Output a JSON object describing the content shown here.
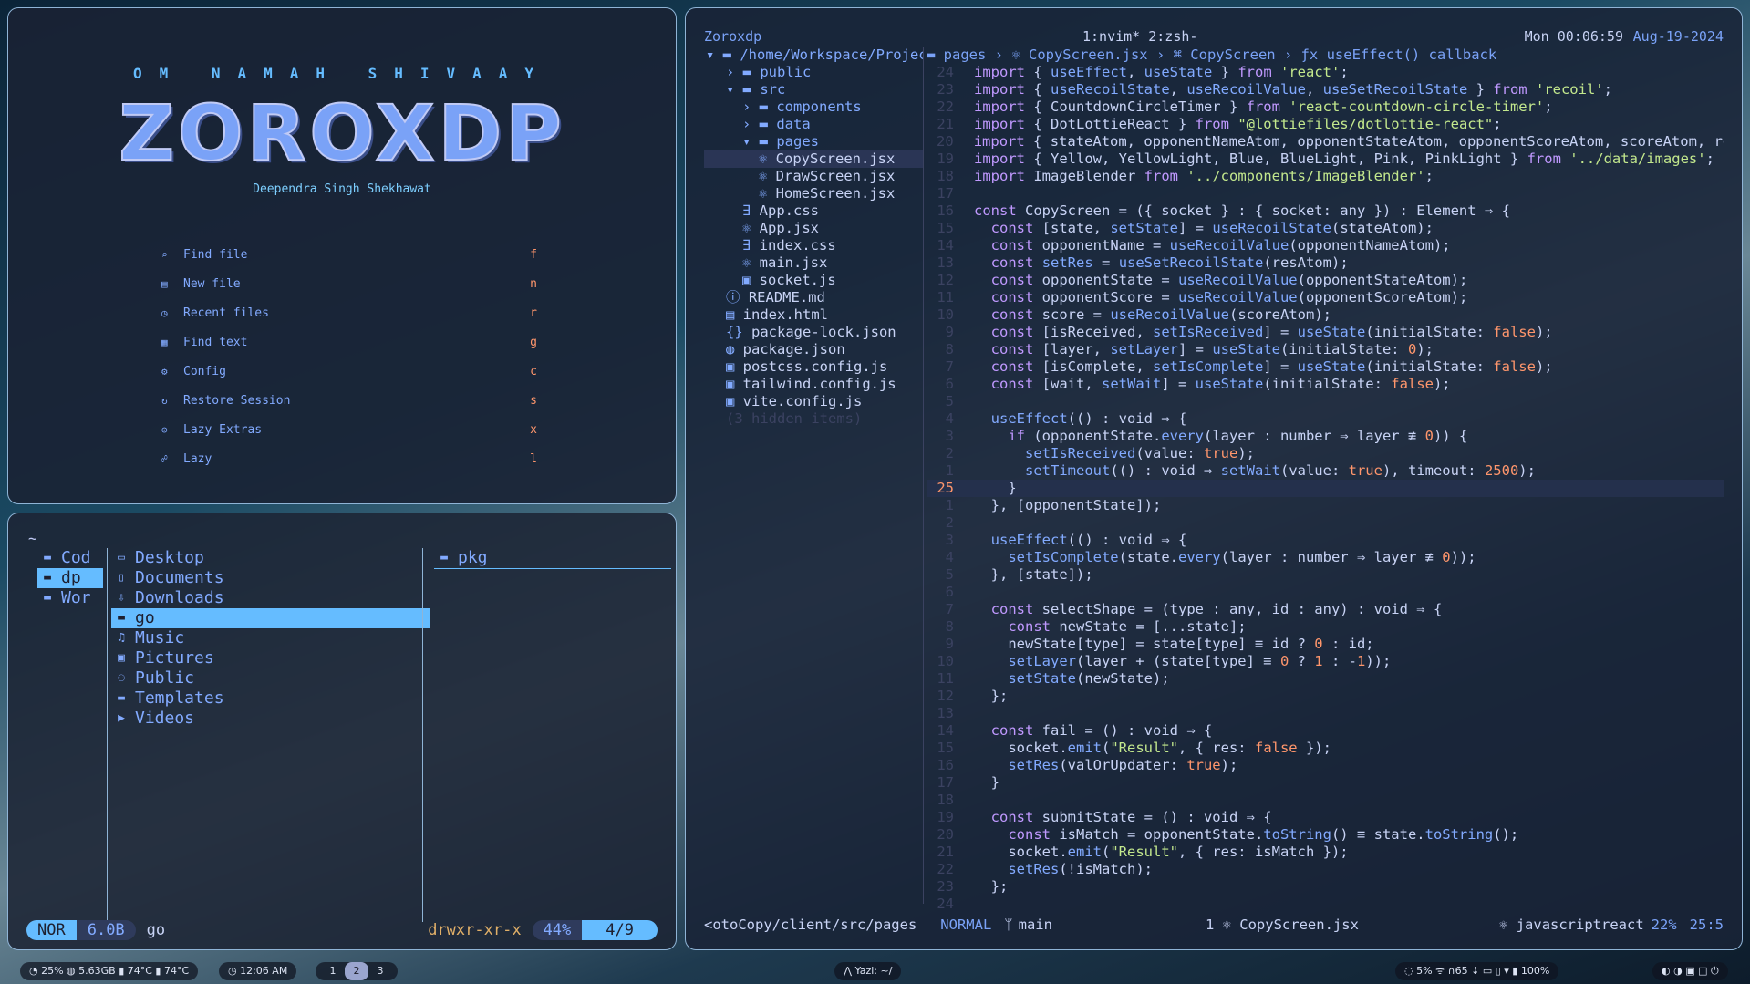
{
  "dashboard": {
    "om": "OM NAMAH SHIVAAY",
    "logo": "ZOROXDP",
    "author": "Deependra Singh Shekhawat",
    "items": [
      {
        "icon": "⌕",
        "label": "Find file",
        "key": "f"
      },
      {
        "icon": "▤",
        "label": "New file",
        "key": "n"
      },
      {
        "icon": "◷",
        "label": "Recent files",
        "key": "r"
      },
      {
        "icon": "▦",
        "label": "Find text",
        "key": "g"
      },
      {
        "icon": "⚙",
        "label": "Config",
        "key": "c"
      },
      {
        "icon": "↻",
        "label": "Restore Session",
        "key": "s"
      },
      {
        "icon": "⊙",
        "label": "Lazy Extras",
        "key": "x"
      },
      {
        "icon": "☍",
        "label": "Lazy",
        "key": "l"
      }
    ]
  },
  "yazi": {
    "cwd": "~",
    "parent": [
      "Cod",
      "dp",
      "Wor"
    ],
    "current": [
      {
        "icon": "▭",
        "name": "Desktop"
      },
      {
        "icon": "▯",
        "name": "Documents"
      },
      {
        "icon": "⇩",
        "name": "Downloads"
      },
      {
        "icon": "▬",
        "name": "go"
      },
      {
        "icon": "♫",
        "name": "Music"
      },
      {
        "icon": "▣",
        "name": "Pictures"
      },
      {
        "icon": "⚇",
        "name": "Public"
      },
      {
        "icon": "▬",
        "name": "Templates"
      },
      {
        "icon": "▶",
        "name": "Videos"
      }
    ],
    "preview": [
      "pkg"
    ],
    "status": {
      "mode": "NOR",
      "size": "6.0B",
      "name": "go",
      "perm": "drwxr-xr-x",
      "percent": "44%",
      "pos": "4/9"
    }
  },
  "nvim": {
    "session": "Zoroxdp",
    "windows": "1:nvim* 2:zsh-",
    "datetime": "Mon 00:06:59",
    "date": "Aug-19-2024",
    "tree": [
      {
        "d": 0,
        "icon": "▾ ▬",
        "name": "/home/Workspace/Project"
      },
      {
        "d": 1,
        "icon": "› ▬",
        "name": "public"
      },
      {
        "d": 1,
        "icon": "▾ ▬",
        "name": "src"
      },
      {
        "d": 2,
        "icon": "› ▬",
        "name": "components"
      },
      {
        "d": 2,
        "icon": "› ▬",
        "name": "data"
      },
      {
        "d": 2,
        "icon": "▾ ▬",
        "name": "pages"
      },
      {
        "d": 3,
        "icon": "⚛",
        "name": "CopyScreen.jsx"
      },
      {
        "d": 3,
        "icon": "⚛",
        "name": "DrawScreen.jsx"
      },
      {
        "d": 3,
        "icon": "⚛",
        "name": "HomeScreen.jsx"
      },
      {
        "d": 2,
        "icon": "∃",
        "name": "App.css"
      },
      {
        "d": 2,
        "icon": "⚛",
        "name": "App.jsx"
      },
      {
        "d": 2,
        "icon": "∃",
        "name": "index.css"
      },
      {
        "d": 2,
        "icon": "⚛",
        "name": "main.jsx"
      },
      {
        "d": 2,
        "icon": "▣",
        "name": "socket.js"
      },
      {
        "d": 1,
        "icon": "ⓘ",
        "name": "README.md"
      },
      {
        "d": 1,
        "icon": "▤",
        "name": "index.html"
      },
      {
        "d": 1,
        "icon": "{}",
        "name": "package-lock.json"
      },
      {
        "d": 1,
        "icon": "◍",
        "name": "package.json"
      },
      {
        "d": 1,
        "icon": "▣",
        "name": "postcss.config.js"
      },
      {
        "d": 1,
        "icon": "▣",
        "name": "tailwind.config.js"
      },
      {
        "d": 1,
        "icon": "▣",
        "name": "vite.config.js"
      },
      {
        "d": 1,
        "icon": "",
        "name": "(3 hidden items)"
      }
    ],
    "breadcrumb": "▬ pages › ⚛ CopyScreen.jsx › ⌘ CopyScreen › ƒx useEffect() callback",
    "lines": [
      {
        "n": "24",
        "t": "import { useEffect, useState } from 'react';"
      },
      {
        "n": "23",
        "t": "import { useRecoilState, useRecoilValue, useSetRecoilState } from 'recoil';"
      },
      {
        "n": "22",
        "t": "import { CountdownCircleTimer } from 'react-countdown-circle-timer';"
      },
      {
        "n": "21",
        "t": "import { DotLottieReact } from \"@lottiefiles/dotlottie-react\";"
      },
      {
        "n": "20",
        "t": "import { stateAtom, opponentNameAtom, opponentStateAtom, opponentScoreAtom, scoreAtom, re"
      },
      {
        "n": "19",
        "t": "import { Yellow, YellowLight, Blue, BlueLight, Pink, PinkLight } from '../data/images';"
      },
      {
        "n": "18",
        "t": "import ImageBlender from '../components/ImageBlender';"
      },
      {
        "n": "17",
        "t": ""
      },
      {
        "n": "16",
        "t": "const CopyScreen = ({ socket } : { socket: any }) : Element ⇒ {"
      },
      {
        "n": "15",
        "t": "  const [state, setState] = useRecoilState(stateAtom);"
      },
      {
        "n": "14",
        "t": "  const opponentName = useRecoilValue(opponentNameAtom);"
      },
      {
        "n": "13",
        "t": "  const setRes = useSetRecoilState(resAtom);"
      },
      {
        "n": "12",
        "t": "  const opponentState = useRecoilValue(opponentStateAtom);"
      },
      {
        "n": "11",
        "t": "  const opponentScore = useRecoilValue(opponentScoreAtom);"
      },
      {
        "n": "10",
        "t": "  const score = useRecoilValue(scoreAtom);"
      },
      {
        "n": "9",
        "t": "  const [isReceived, setIsReceived] = useState(initialState: false);"
      },
      {
        "n": "8",
        "t": "  const [layer, setLayer] = useState(initialState: 0);"
      },
      {
        "n": "7",
        "t": "  const [isComplete, setIsComplete] = useState(initialState: false);"
      },
      {
        "n": "6",
        "t": "  const [wait, setWait] = useState(initialState: false);"
      },
      {
        "n": "5",
        "t": ""
      },
      {
        "n": "4",
        "t": "  useEffect(() : void ⇒ {"
      },
      {
        "n": "3",
        "t": "    if (opponentState.every(layer : number ⇒ layer ≢ 0)) {"
      },
      {
        "n": "2",
        "t": "      setIsReceived(value: true);"
      },
      {
        "n": "1",
        "t": "      setTimeout(() : void ⇒ setWait(value: true), timeout: 2500);"
      },
      {
        "n": "25",
        "t": "    }",
        "cur": true
      },
      {
        "n": "1",
        "t": "  }, [opponentState]);"
      },
      {
        "n": "2",
        "t": ""
      },
      {
        "n": "3",
        "t": "  useEffect(() : void ⇒ {"
      },
      {
        "n": "4",
        "t": "    setIsComplete(state.every(layer : number ⇒ layer ≢ 0));"
      },
      {
        "n": "5",
        "t": "  }, [state]);"
      },
      {
        "n": "6",
        "t": ""
      },
      {
        "n": "7",
        "t": "  const selectShape = (type : any, id : any) : void ⇒ {"
      },
      {
        "n": "8",
        "t": "    const newState = [...state];"
      },
      {
        "n": "9",
        "t": "    newState[type] = state[type] ≡ id ? 0 : id;"
      },
      {
        "n": "10",
        "t": "    setLayer(layer + (state[type] ≡ 0 ? 1 : -1));"
      },
      {
        "n": "11",
        "t": "    setState(newState);"
      },
      {
        "n": "12",
        "t": "  };"
      },
      {
        "n": "13",
        "t": ""
      },
      {
        "n": "14",
        "t": "  const fail = () : void ⇒ {"
      },
      {
        "n": "15",
        "t": "    socket.emit(\"Result\", { res: false });"
      },
      {
        "n": "16",
        "t": "    setRes(valOrUpdater: true);"
      },
      {
        "n": "17",
        "t": "  }"
      },
      {
        "n": "18",
        "t": ""
      },
      {
        "n": "19",
        "t": "  const submitState = () : void ⇒ {"
      },
      {
        "n": "20",
        "t": "    const isMatch = opponentState.toString() ≡ state.toString();"
      },
      {
        "n": "21",
        "t": "    socket.emit(\"Result\", { res: isMatch });"
      },
      {
        "n": "22",
        "t": "    setRes(!isMatch);"
      },
      {
        "n": "23",
        "t": "  };"
      },
      {
        "n": "24",
        "t": ""
      }
    ],
    "status": {
      "path": "<otoCopy/client/src/pages",
      "mode": "NORMAL",
      "branch": "main",
      "buf": "1 ⚛ CopyScreen.jsx",
      "ft": "⚛ javascriptreact",
      "pct": "22%",
      "pos": "25:5"
    }
  },
  "taskbar": {
    "stats": "◔ 25%  ◍ 5.63GB  ▮ 74°C  ▮ 74°C",
    "clock": "◷ 12:06 AM",
    "workspaces": [
      "1",
      "2",
      "3"
    ],
    "active_ws": "2",
    "window": "⋀ Yazi: ~/",
    "tray": "◌ 5%  ᯤ  ∩65  ⇣  ▭  ▯  ▾  ▮ 100%",
    "tray_icons": "◐ ◑ ▣ ◫ ⏻"
  },
  "colors": {
    "accent": "#65bcff",
    "keyword": "#c099ff",
    "string": "#c3e88d",
    "orange": "#ff966c"
  }
}
